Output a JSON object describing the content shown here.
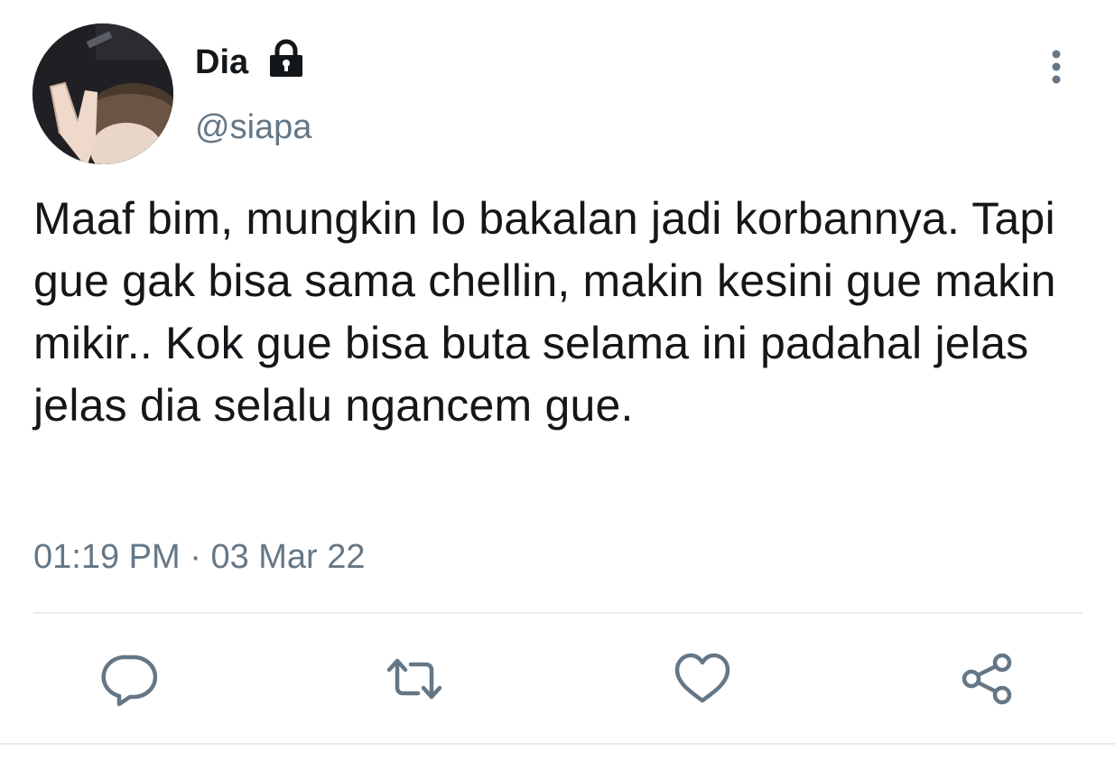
{
  "author": {
    "display_name": "Dia",
    "handle": "@siapa",
    "protected_icon": "lock-icon",
    "avatar_icon": "profile-photo-peace-sign"
  },
  "tweet": {
    "text": "Maaf bim, mungkin lo bakalan jadi korbannya. Tapi gue gak bisa sama chellin, makin kesini gue makin mikir.. Kok gue bisa buta selama ini padahal jelas jelas dia selalu ngancem gue.",
    "time": "01:19 PM",
    "separator": "·",
    "date": "03 Mar 22"
  },
  "actions": [
    {
      "name": "reply",
      "icon": "comment-icon"
    },
    {
      "name": "retweet",
      "icon": "retweet-icon"
    },
    {
      "name": "like",
      "icon": "heart-icon"
    },
    {
      "name": "share",
      "icon": "share-icon"
    }
  ],
  "menu_icon": "more-vertical-icon",
  "colors": {
    "text": "#14171a",
    "secondary": "#657786",
    "divider": "#e6ecf0",
    "icon": "#657786"
  }
}
